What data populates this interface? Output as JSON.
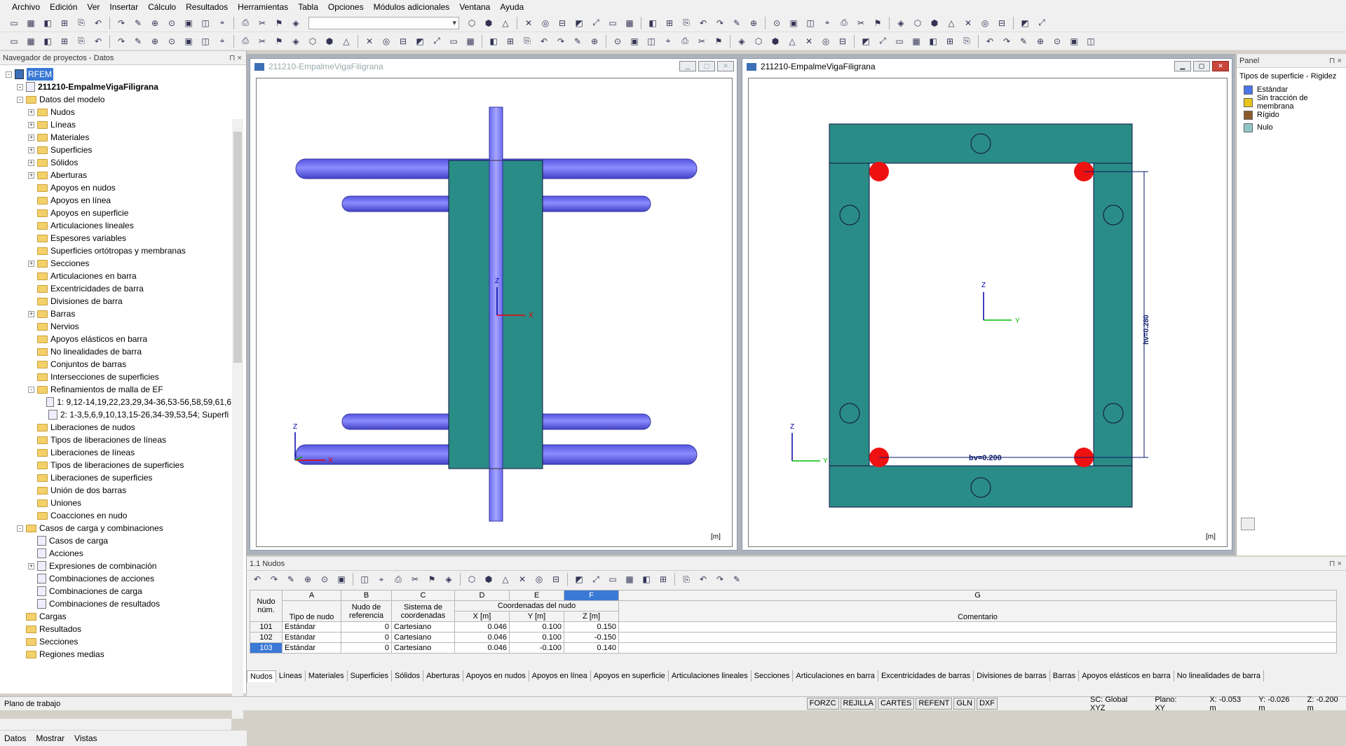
{
  "menu": [
    "Archivo",
    "Edición",
    "Ver",
    "Insertar",
    "Cálculo",
    "Resultados",
    "Herramientas",
    "Tabla",
    "Opciones",
    "Módulos adicionales",
    "Ventana",
    "Ayuda"
  ],
  "navigator": {
    "title": "Navegador de proyectos - Datos",
    "pin": "⊓ ×",
    "root": "RFEM",
    "project": "211210-EmpalmeVigaFiligrana",
    "items": [
      {
        "label": "Datos del modelo",
        "level": 1,
        "exp": "-",
        "icon": "folder"
      },
      {
        "label": "Nudos",
        "level": 2,
        "exp": "+",
        "icon": "folder"
      },
      {
        "label": "Líneas",
        "level": 2,
        "exp": "+",
        "icon": "folder"
      },
      {
        "label": "Materiales",
        "level": 2,
        "exp": "+",
        "icon": "folder"
      },
      {
        "label": "Superficies",
        "level": 2,
        "exp": "+",
        "icon": "folder"
      },
      {
        "label": "Sólidos",
        "level": 2,
        "exp": "+",
        "icon": "folder"
      },
      {
        "label": "Aberturas",
        "level": 2,
        "exp": "+",
        "icon": "folder"
      },
      {
        "label": "Apoyos en nudos",
        "level": 2,
        "exp": "",
        "icon": "folder"
      },
      {
        "label": "Apoyos en línea",
        "level": 2,
        "exp": "",
        "icon": "folder"
      },
      {
        "label": "Apoyos en superficie",
        "level": 2,
        "exp": "",
        "icon": "folder"
      },
      {
        "label": "Articulaciones lineales",
        "level": 2,
        "exp": "",
        "icon": "folder"
      },
      {
        "label": "Espesores variables",
        "level": 2,
        "exp": "",
        "icon": "folder"
      },
      {
        "label": "Superficies ortótropas y membranas",
        "level": 2,
        "exp": "",
        "icon": "folder"
      },
      {
        "label": "Secciones",
        "level": 2,
        "exp": "+",
        "icon": "folder"
      },
      {
        "label": "Articulaciones en barra",
        "level": 2,
        "exp": "",
        "icon": "folder"
      },
      {
        "label": "Excentricidades de barra",
        "level": 2,
        "exp": "",
        "icon": "folder"
      },
      {
        "label": "Divisiones de barra",
        "level": 2,
        "exp": "",
        "icon": "folder"
      },
      {
        "label": "Barras",
        "level": 2,
        "exp": "+",
        "icon": "folder"
      },
      {
        "label": "Nervios",
        "level": 2,
        "exp": "",
        "icon": "folder"
      },
      {
        "label": "Apoyos elásticos en barra",
        "level": 2,
        "exp": "",
        "icon": "folder"
      },
      {
        "label": "No linealidades de barra",
        "level": 2,
        "exp": "",
        "icon": "folder"
      },
      {
        "label": "Conjuntos de barras",
        "level": 2,
        "exp": "",
        "icon": "folder"
      },
      {
        "label": "Intersecciones de superficies",
        "level": 2,
        "exp": "",
        "icon": "folder"
      },
      {
        "label": "Refinamientos de malla de EF",
        "level": 2,
        "exp": "-",
        "icon": "folder"
      },
      {
        "label": "1: 9,12-14,19,22,23,29,34-36,53-56,58,59,61,6",
        "level": 3,
        "exp": "",
        "icon": "doc"
      },
      {
        "label": "2: 1-3,5,6,9,10,13,15-26,34-39,53,54; Superfi",
        "level": 3,
        "exp": "",
        "icon": "doc"
      },
      {
        "label": "Liberaciones de nudos",
        "level": 2,
        "exp": "",
        "icon": "folder"
      },
      {
        "label": "Tipos de liberaciones de líneas",
        "level": 2,
        "exp": "",
        "icon": "folder"
      },
      {
        "label": "Liberaciones de líneas",
        "level": 2,
        "exp": "",
        "icon": "folder"
      },
      {
        "label": "Tipos de liberaciones de superficies",
        "level": 2,
        "exp": "",
        "icon": "folder"
      },
      {
        "label": "Liberaciones de superficies",
        "level": 2,
        "exp": "",
        "icon": "folder"
      },
      {
        "label": "Unión de dos barras",
        "level": 2,
        "exp": "",
        "icon": "folder"
      },
      {
        "label": "Uniones",
        "level": 2,
        "exp": "",
        "icon": "folder"
      },
      {
        "label": "Coacciones en nudo",
        "level": 2,
        "exp": "",
        "icon": "folder"
      },
      {
        "label": "Casos de carga y combinaciones",
        "level": 1,
        "exp": "-",
        "icon": "folder"
      },
      {
        "label": "Casos de carga",
        "level": 2,
        "exp": "",
        "icon": "doc"
      },
      {
        "label": "Acciones",
        "level": 2,
        "exp": "",
        "icon": "doc"
      },
      {
        "label": "Expresiones de combinación",
        "level": 2,
        "exp": "+",
        "icon": "doc"
      },
      {
        "label": "Combinaciones de acciones",
        "level": 2,
        "exp": "",
        "icon": "doc"
      },
      {
        "label": "Combinaciones de carga",
        "level": 2,
        "exp": "",
        "icon": "doc"
      },
      {
        "label": "Combinaciones de resultados",
        "level": 2,
        "exp": "",
        "icon": "doc"
      },
      {
        "label": "Cargas",
        "level": 1,
        "exp": "",
        "icon": "folder"
      },
      {
        "label": "Resultados",
        "level": 1,
        "exp": "",
        "icon": "folder"
      },
      {
        "label": "Secciones",
        "level": 1,
        "exp": "",
        "icon": "folder"
      },
      {
        "label": "Regiones medias",
        "level": 1,
        "exp": "",
        "icon": "folder"
      }
    ],
    "tabs": [
      "Datos",
      "Mostrar",
      "Vistas"
    ]
  },
  "windows": {
    "left_title": "211210-EmpalmeVigaFiligrana",
    "right_title": "211210-EmpalmeVigaFiligrana",
    "unit": "[m]",
    "axis_z": "Z",
    "axis_x": "X",
    "axis_y": "Y",
    "dim_bv": "bv=0.200",
    "dim_hv": "hv=0.280"
  },
  "colors": {
    "teal": "#2a8c86",
    "bar": "#6a6af0",
    "red": "#ee1111"
  },
  "panel": {
    "title": "Panel",
    "subtitle": "Tipos de superficie - Rigidez",
    "legend": [
      {
        "label": "Estándar",
        "color": "#4b74e8"
      },
      {
        "label": "Sin tracción de membrana",
        "color": "#e8c51a"
      },
      {
        "label": "Rígido",
        "color": "#8b5a2b"
      },
      {
        "label": "Nulo",
        "color": "#8fc5c9"
      }
    ]
  },
  "table": {
    "title": "1.1 Nudos",
    "col_letters": [
      "A",
      "B",
      "C",
      "D",
      "E",
      "F",
      "G"
    ],
    "hdr": {
      "nudo": "Nudo",
      "num": "núm.",
      "tipo": "Tipo de nudo",
      "ref1": "Nudo de",
      "ref2": "referencia",
      "sis1": "Sistema de",
      "sis2": "coordenadas",
      "coord": "Coordenadas del nudo",
      "x": "X [m]",
      "y": "Y [m]",
      "z": "Z [m]",
      "com": "Comentario"
    },
    "rows": [
      {
        "no": "101",
        "tipo": "Estándar",
        "ref": "0",
        "sis": "Cartesiano",
        "x": "0.046",
        "y": "0.100",
        "z": "0.150"
      },
      {
        "no": "102",
        "tipo": "Estándar",
        "ref": "0",
        "sis": "Cartesiano",
        "x": "0.046",
        "y": "0.100",
        "z": "-0.150"
      },
      {
        "no": "103",
        "tipo": "Estándar",
        "ref": "0",
        "sis": "Cartesiano",
        "x": "0.046",
        "y": "-0.100",
        "z": "0.140"
      }
    ],
    "tabs": [
      "Nudos",
      "Líneas",
      "Materiales",
      "Superficies",
      "Sólidos",
      "Aberturas",
      "Apoyos en nudos",
      "Apoyos en línea",
      "Apoyos en superficie",
      "Articulaciones lineales",
      "Secciones",
      "Articulaciones en barra",
      "Excentricidades de barras",
      "Divisiones de barras",
      "Barras",
      "Apoyos elásticos en barra",
      "No linealidades de barra"
    ]
  },
  "status": {
    "left": "Plano de trabajo",
    "buttons": [
      "FORZC",
      "REJILLA",
      "CARTES",
      "REFENT",
      "GLN",
      "DXF"
    ],
    "sc": "SC: Global XYZ",
    "plane": "Plano: XY",
    "x": "X: -0.053 m",
    "y": "Y: -0.026 m",
    "z": "Z: -0.200 m"
  }
}
